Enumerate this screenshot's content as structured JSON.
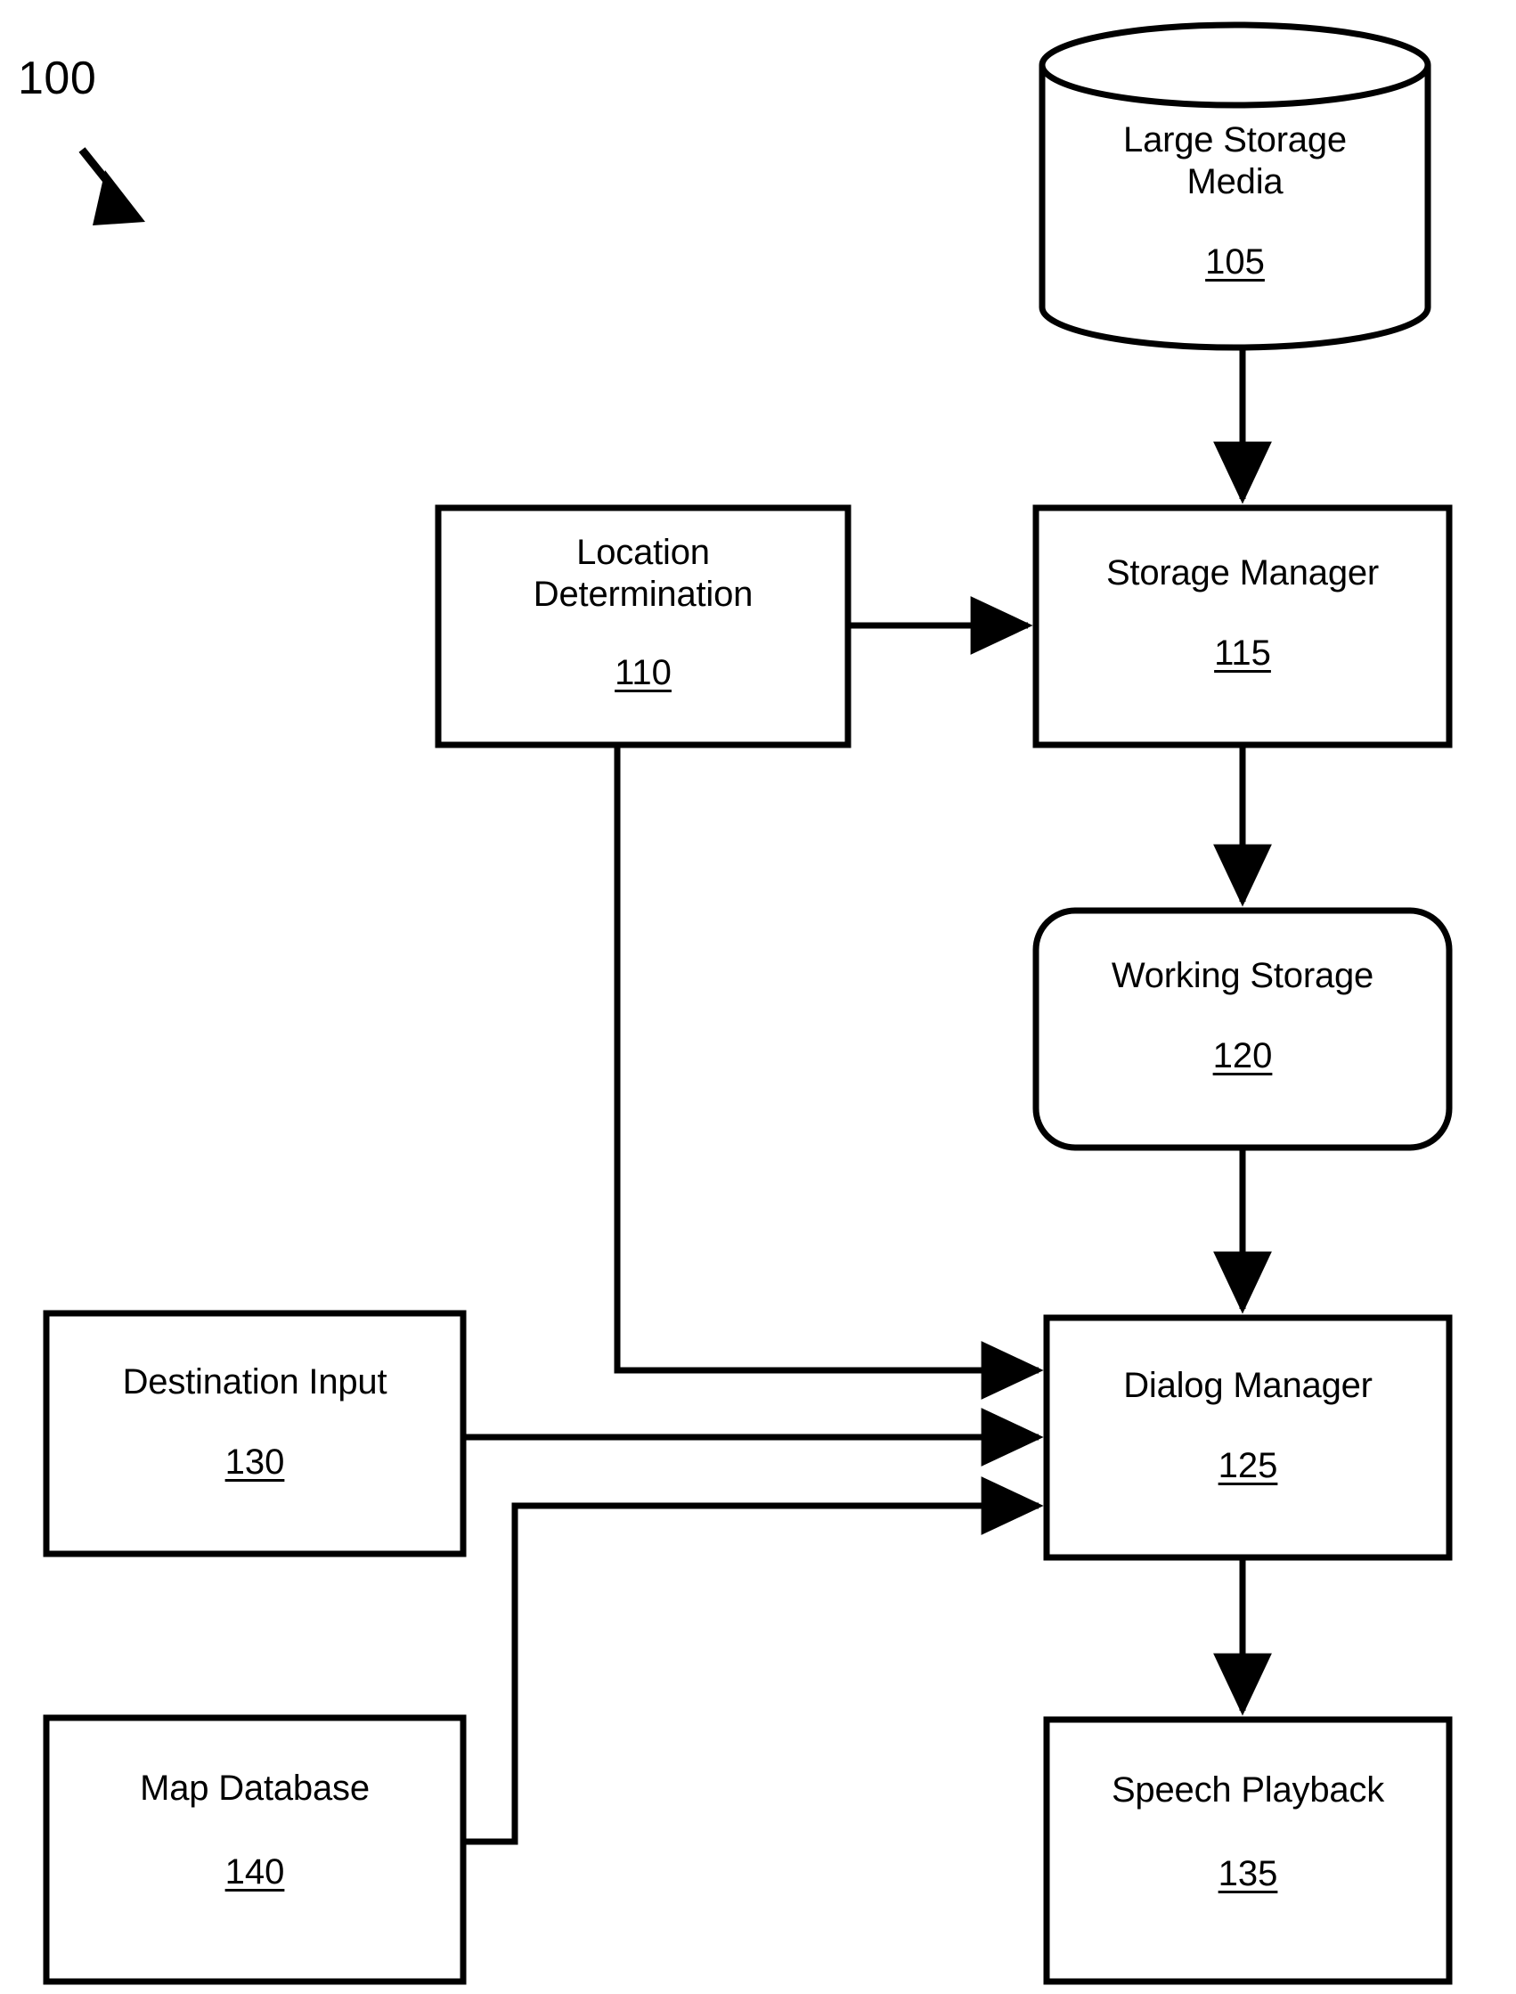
{
  "figure": {
    "number": "100",
    "pointer_icon": "diagonal-arrow-icon"
  },
  "nodes": {
    "large_storage_media": {
      "title": "Large Storage\nMedia",
      "ref": "105",
      "shape": "cylinder"
    },
    "location_determination": {
      "title": "Location\nDetermination",
      "ref": "110",
      "shape": "rectangle"
    },
    "storage_manager": {
      "title": "Storage Manager",
      "ref": "115",
      "shape": "rectangle"
    },
    "working_storage": {
      "title": "Working Storage",
      "ref": "120",
      "shape": "rounded-rectangle"
    },
    "dialog_manager": {
      "title": "Dialog Manager",
      "ref": "125",
      "shape": "rectangle"
    },
    "destination_input": {
      "title": "Destination Input",
      "ref": "130",
      "shape": "rectangle"
    },
    "speech_playback": {
      "title": "Speech Playback",
      "ref": "135",
      "shape": "rectangle"
    },
    "map_database": {
      "title": "Map Database",
      "ref": "140",
      "shape": "rectangle"
    }
  },
  "connections": [
    {
      "name": "large-storage-media-to-storage-manager",
      "from": "large_storage_media",
      "to": "storage_manager"
    },
    {
      "name": "location-determination-to-storage-manager",
      "from": "location_determination",
      "to": "storage_manager"
    },
    {
      "name": "storage-manager-to-working-storage",
      "from": "storage_manager",
      "to": "working_storage"
    },
    {
      "name": "working-storage-to-dialog-manager",
      "from": "working_storage",
      "to": "dialog_manager"
    },
    {
      "name": "location-determination-to-dialog-manager",
      "from": "location_determination",
      "to": "dialog_manager"
    },
    {
      "name": "destination-input-to-dialog-manager",
      "from": "destination_input",
      "to": "dialog_manager"
    },
    {
      "name": "map-database-to-dialog-manager",
      "from": "map_database",
      "to": "dialog_manager"
    },
    {
      "name": "dialog-manager-to-speech-playback",
      "from": "dialog_manager",
      "to": "speech_playback"
    }
  ],
  "style": {
    "stroke": "#000000",
    "background": "#ffffff"
  }
}
